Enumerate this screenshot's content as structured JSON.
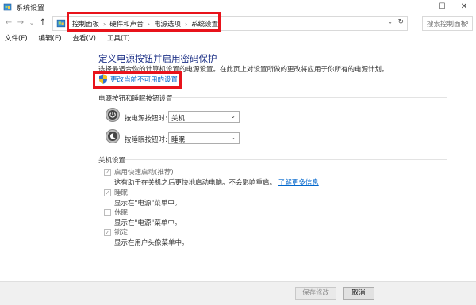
{
  "window": {
    "title": "系统设置",
    "minimize_glyph": "─",
    "maximize_glyph": "☐",
    "close_glyph": "✕"
  },
  "nav": {
    "back_glyph": "←",
    "forward_glyph": "→",
    "recent_glyph": "⌄",
    "up_glyph": "↑"
  },
  "address": {
    "breadcrumbs": [
      "控制面板",
      "硬件和声音",
      "电源选项",
      "系统设置"
    ],
    "separator": "›",
    "dropdown_glyph": "⌄",
    "refresh_glyph": "↻"
  },
  "search": {
    "placeholder": "搜索控制面板",
    "icon_glyph": "⌕"
  },
  "menu": {
    "items": [
      "文件(F)",
      "编辑(E)",
      "查看(V)",
      "工具(T)"
    ]
  },
  "main": {
    "title": "定义电源按钮并启用密码保护",
    "description": "选择最适合你的计算机设置的电源设置。在此页上对设置所做的更改将应用于你所有的电源计划。",
    "change_link": "更改当前不可用的设置"
  },
  "power_buttons": {
    "heading": "电源按钮和睡眠按钮设置",
    "rows": [
      {
        "label": "按电源按钮时:",
        "value": "关机"
      },
      {
        "label": "按睡眠按钮时:",
        "value": "睡眠"
      }
    ],
    "dropdown_glyph": "⌄"
  },
  "shutdown": {
    "heading": "关机设置",
    "items": [
      {
        "label": "启用快速启动(推荐)",
        "checked": true,
        "desc": "这有助于在关机之后更快地启动电脑。不会影响重启。",
        "link": "了解更多信息"
      },
      {
        "label": "睡眠",
        "checked": true,
        "desc": "显示在\"电源\"菜单中。"
      },
      {
        "label": "休眠",
        "checked": false,
        "desc": "显示在\"电源\"菜单中。"
      },
      {
        "label": "锁定",
        "checked": true,
        "desc": "显示在用户头像菜单中。"
      }
    ],
    "check_glyph": "✓"
  },
  "footer": {
    "save_label": "保存修改",
    "cancel_label": "取消"
  },
  "colors": {
    "highlight_border": "#e8131b",
    "title_blue": "#1e3287",
    "link_blue": "#0066cc"
  }
}
